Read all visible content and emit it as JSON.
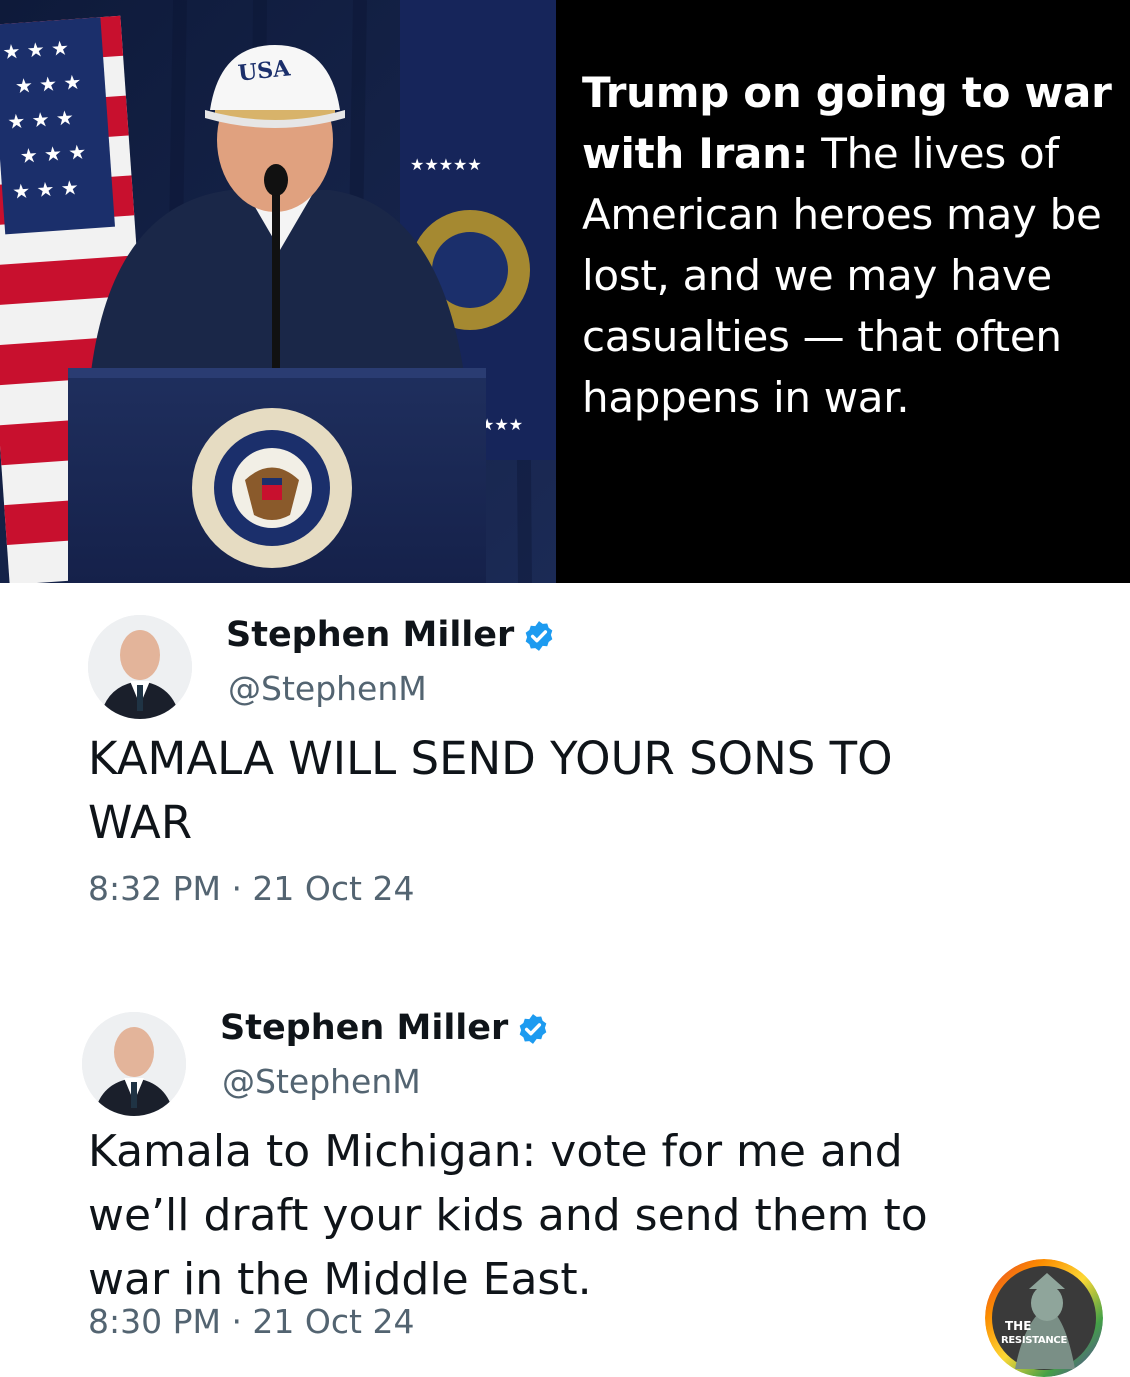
{
  "header": {
    "caption_bold": "Trump on going to war with Iran:",
    "caption_rest": " The lives of American heroes may be lost, and we may have casualties — that often happens in war.",
    "cap_text": "USA",
    "seal_text": "SEAL OF THE PRESIDENT OF THE UNITED STATES"
  },
  "tweets": [
    {
      "name": "Stephen Miller",
      "handle": "@StephenM",
      "text": "KAMALA WILL SEND YOUR SONS TO WAR",
      "time": "8:32 PM · 21 Oct 24"
    },
    {
      "name": "Stephen Miller",
      "handle": "@StephenM",
      "text": "Kamala to Michigan: vote for me and we’ll draft your kids and send them to war in the Middle East.",
      "time": "8:30 PM · 21 Oct 24"
    }
  ],
  "watermark": {
    "line1": "THE",
    "line2": "RESISTANCE"
  },
  "colors": {
    "verified": "#1d9bf0",
    "secondary_text": "#536471",
    "primary_text": "#0f1419"
  }
}
